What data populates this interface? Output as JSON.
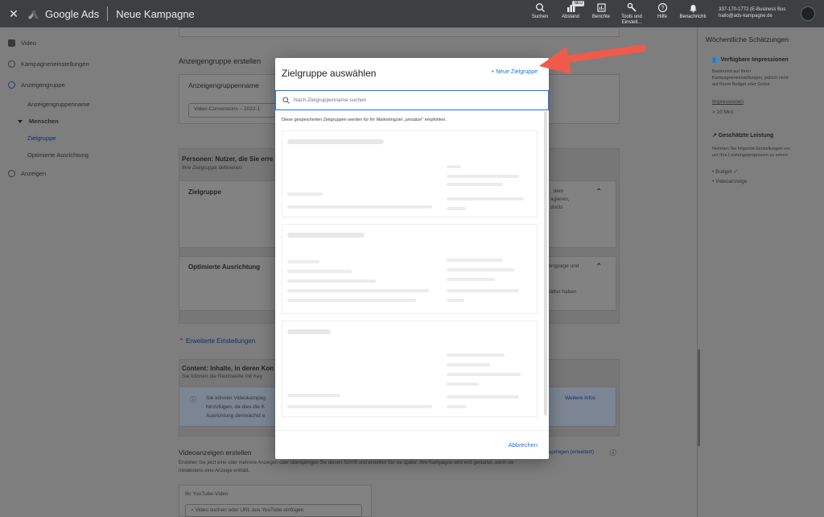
{
  "topbar": {
    "brand": "Google Ads",
    "campaign": "Neue Kampagne",
    "nav": [
      {
        "icon": "search-icon",
        "label": "Suchen"
      },
      {
        "icon": "bar-chart-icon",
        "label": "Abstand",
        "badge": "NEU"
      },
      {
        "icon": "report-icon",
        "label": "Berichte"
      },
      {
        "icon": "wrench-icon",
        "label": "Tools und Einstell..."
      },
      {
        "icon": "help-icon",
        "label": "Hilfe"
      },
      {
        "icon": "bell-icon",
        "label": "Benachrichti"
      }
    ],
    "account_line1": "337-170-1772 (E-Business Bus",
    "account_line2": "hallo@ads-kampagne.de"
  },
  "sidebar": {
    "items": [
      {
        "label": "Video"
      },
      {
        "label": "Kampagneneinstellungen"
      },
      {
        "label": "Anzeigengruppe"
      },
      {
        "label": "Anzeigengruppenname"
      },
      {
        "label": "Menschen"
      },
      {
        "label": "Zielgruppe"
      },
      {
        "label": "Optimierte Ausrichtung"
      },
      {
        "label": "Anzeigen"
      }
    ]
  },
  "main": {
    "adgroup_heading": "Anzeigengruppe erstellen",
    "adgroup_name_label": "Anzeigengruppenname",
    "adgroup_name_value": "Video-Conversions – 2022-1",
    "personen_title": "Personen: Nutzer, die Sie erre",
    "personen_sub": "Ihre Zielgruppe definieren",
    "zielgruppe": "Zielgruppe",
    "zielgruppe_side1": ", dem",
    "zielgruppe_side2": "agieren,",
    "zielgruppe_side3": "ducts",
    "optimiert": "Optimierte Ausrichtung",
    "optimiert_side1": "dingpage und",
    "optimiert_side2": "hätter haben",
    "erweitert": "Erweiterte Einstellungen",
    "content_title": "Content: Inhalte, in deren Kon",
    "content_sub": "Sie können die Reichweite mit Key",
    "info1": "Sie können Videokampag",
    "info2": "hinzufügen, da dies die K",
    "info3": "Ausrichtung demnächst e",
    "weitere": "Weitere Infos",
    "video_heading": "Videoanzeigen erstellen",
    "video_skip": "springen (erweitert)",
    "video_desc1": "Erstellen Sie jetzt eine oder mehrere Anzeigen oder überspringen Sie diesen Schritt und erstellen Sie sie später. Ihre Kampagne wird erst gestartet, wenn sie",
    "video_desc2": "mindestens eine Anzeige enthält.",
    "yt_label": "Ihr YouTube-Video",
    "yt_placeholder": "Video suchen oder URL aus YouTube einfügen"
  },
  "right": {
    "title": "Wöchentliche Schätzungen",
    "impr_title": "Verfügbare Impressionen",
    "impr_desc1": "Basierend auf Ihren",
    "impr_desc2": "Kampagneneinstellungen, jedoch nicht",
    "impr_desc3": "auf Ihrem Budget oder Gebot",
    "impr_label": "Impressionen",
    "impr_value": "> 10 Mrd.",
    "perf_title": "Geschätzte Leistung",
    "perf_desc1": "Nehmen Sie folgende Einstellungen vor,",
    "perf_desc2": "um Ihre Leistungsprognosen zu sehen:",
    "bullet1": "Budget",
    "bullet2": "Videoanzeige"
  },
  "modal": {
    "title": "Zielgruppe auswählen",
    "new_button": "+ Neue Zielgruppe",
    "search_placeholder": "Nach Zielgruppenname suchen",
    "hint": "Diese gespeicherten Zielgruppen werden für Ihr Marketingziel „umsätze\" empfohlen.",
    "cancel": "Abbrechen"
  },
  "colors": {
    "accent": "#1a73e8",
    "arrow": "#f05a4a",
    "topbar": "#3c4043"
  }
}
